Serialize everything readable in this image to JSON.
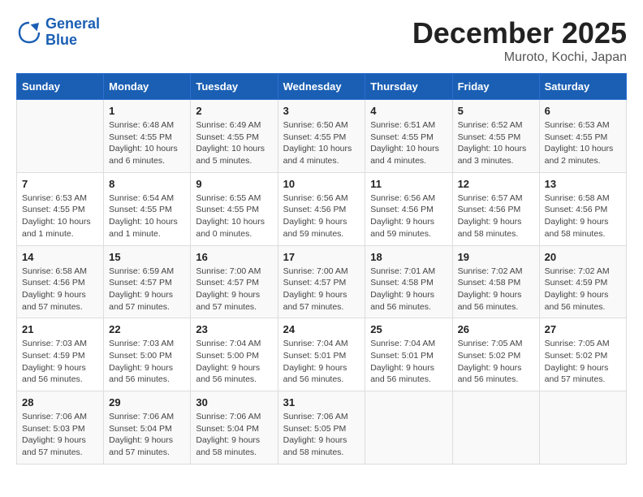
{
  "header": {
    "logo_line1": "General",
    "logo_line2": "Blue",
    "month": "December 2025",
    "location": "Muroto, Kochi, Japan"
  },
  "weekdays": [
    "Sunday",
    "Monday",
    "Tuesday",
    "Wednesday",
    "Thursday",
    "Friday",
    "Saturday"
  ],
  "weeks": [
    [
      {
        "day": "",
        "sunrise": "",
        "sunset": "",
        "daylight": ""
      },
      {
        "day": "1",
        "sunrise": "Sunrise: 6:48 AM",
        "sunset": "Sunset: 4:55 PM",
        "daylight": "Daylight: 10 hours and 6 minutes."
      },
      {
        "day": "2",
        "sunrise": "Sunrise: 6:49 AM",
        "sunset": "Sunset: 4:55 PM",
        "daylight": "Daylight: 10 hours and 5 minutes."
      },
      {
        "day": "3",
        "sunrise": "Sunrise: 6:50 AM",
        "sunset": "Sunset: 4:55 PM",
        "daylight": "Daylight: 10 hours and 4 minutes."
      },
      {
        "day": "4",
        "sunrise": "Sunrise: 6:51 AM",
        "sunset": "Sunset: 4:55 PM",
        "daylight": "Daylight: 10 hours and 4 minutes."
      },
      {
        "day": "5",
        "sunrise": "Sunrise: 6:52 AM",
        "sunset": "Sunset: 4:55 PM",
        "daylight": "Daylight: 10 hours and 3 minutes."
      },
      {
        "day": "6",
        "sunrise": "Sunrise: 6:53 AM",
        "sunset": "Sunset: 4:55 PM",
        "daylight": "Daylight: 10 hours and 2 minutes."
      }
    ],
    [
      {
        "day": "7",
        "sunrise": "Sunrise: 6:53 AM",
        "sunset": "Sunset: 4:55 PM",
        "daylight": "Daylight: 10 hours and 1 minute."
      },
      {
        "day": "8",
        "sunrise": "Sunrise: 6:54 AM",
        "sunset": "Sunset: 4:55 PM",
        "daylight": "Daylight: 10 hours and 1 minute."
      },
      {
        "day": "9",
        "sunrise": "Sunrise: 6:55 AM",
        "sunset": "Sunset: 4:55 PM",
        "daylight": "Daylight: 10 hours and 0 minutes."
      },
      {
        "day": "10",
        "sunrise": "Sunrise: 6:56 AM",
        "sunset": "Sunset: 4:56 PM",
        "daylight": "Daylight: 9 hours and 59 minutes."
      },
      {
        "day": "11",
        "sunrise": "Sunrise: 6:56 AM",
        "sunset": "Sunset: 4:56 PM",
        "daylight": "Daylight: 9 hours and 59 minutes."
      },
      {
        "day": "12",
        "sunrise": "Sunrise: 6:57 AM",
        "sunset": "Sunset: 4:56 PM",
        "daylight": "Daylight: 9 hours and 58 minutes."
      },
      {
        "day": "13",
        "sunrise": "Sunrise: 6:58 AM",
        "sunset": "Sunset: 4:56 PM",
        "daylight": "Daylight: 9 hours and 58 minutes."
      }
    ],
    [
      {
        "day": "14",
        "sunrise": "Sunrise: 6:58 AM",
        "sunset": "Sunset: 4:56 PM",
        "daylight": "Daylight: 9 hours and 57 minutes."
      },
      {
        "day": "15",
        "sunrise": "Sunrise: 6:59 AM",
        "sunset": "Sunset: 4:57 PM",
        "daylight": "Daylight: 9 hours and 57 minutes."
      },
      {
        "day": "16",
        "sunrise": "Sunrise: 7:00 AM",
        "sunset": "Sunset: 4:57 PM",
        "daylight": "Daylight: 9 hours and 57 minutes."
      },
      {
        "day": "17",
        "sunrise": "Sunrise: 7:00 AM",
        "sunset": "Sunset: 4:57 PM",
        "daylight": "Daylight: 9 hours and 57 minutes."
      },
      {
        "day": "18",
        "sunrise": "Sunrise: 7:01 AM",
        "sunset": "Sunset: 4:58 PM",
        "daylight": "Daylight: 9 hours and 56 minutes."
      },
      {
        "day": "19",
        "sunrise": "Sunrise: 7:02 AM",
        "sunset": "Sunset: 4:58 PM",
        "daylight": "Daylight: 9 hours and 56 minutes."
      },
      {
        "day": "20",
        "sunrise": "Sunrise: 7:02 AM",
        "sunset": "Sunset: 4:59 PM",
        "daylight": "Daylight: 9 hours and 56 minutes."
      }
    ],
    [
      {
        "day": "21",
        "sunrise": "Sunrise: 7:03 AM",
        "sunset": "Sunset: 4:59 PM",
        "daylight": "Daylight: 9 hours and 56 minutes."
      },
      {
        "day": "22",
        "sunrise": "Sunrise: 7:03 AM",
        "sunset": "Sunset: 5:00 PM",
        "daylight": "Daylight: 9 hours and 56 minutes."
      },
      {
        "day": "23",
        "sunrise": "Sunrise: 7:04 AM",
        "sunset": "Sunset: 5:00 PM",
        "daylight": "Daylight: 9 hours and 56 minutes."
      },
      {
        "day": "24",
        "sunrise": "Sunrise: 7:04 AM",
        "sunset": "Sunset: 5:01 PM",
        "daylight": "Daylight: 9 hours and 56 minutes."
      },
      {
        "day": "25",
        "sunrise": "Sunrise: 7:04 AM",
        "sunset": "Sunset: 5:01 PM",
        "daylight": "Daylight: 9 hours and 56 minutes."
      },
      {
        "day": "26",
        "sunrise": "Sunrise: 7:05 AM",
        "sunset": "Sunset: 5:02 PM",
        "daylight": "Daylight: 9 hours and 56 minutes."
      },
      {
        "day": "27",
        "sunrise": "Sunrise: 7:05 AM",
        "sunset": "Sunset: 5:02 PM",
        "daylight": "Daylight: 9 hours and 57 minutes."
      }
    ],
    [
      {
        "day": "28",
        "sunrise": "Sunrise: 7:06 AM",
        "sunset": "Sunset: 5:03 PM",
        "daylight": "Daylight: 9 hours and 57 minutes."
      },
      {
        "day": "29",
        "sunrise": "Sunrise: 7:06 AM",
        "sunset": "Sunset: 5:04 PM",
        "daylight": "Daylight: 9 hours and 57 minutes."
      },
      {
        "day": "30",
        "sunrise": "Sunrise: 7:06 AM",
        "sunset": "Sunset: 5:04 PM",
        "daylight": "Daylight: 9 hours and 58 minutes."
      },
      {
        "day": "31",
        "sunrise": "Sunrise: 7:06 AM",
        "sunset": "Sunset: 5:05 PM",
        "daylight": "Daylight: 9 hours and 58 minutes."
      },
      {
        "day": "",
        "sunrise": "",
        "sunset": "",
        "daylight": ""
      },
      {
        "day": "",
        "sunrise": "",
        "sunset": "",
        "daylight": ""
      },
      {
        "day": "",
        "sunrise": "",
        "sunset": "",
        "daylight": ""
      }
    ]
  ]
}
